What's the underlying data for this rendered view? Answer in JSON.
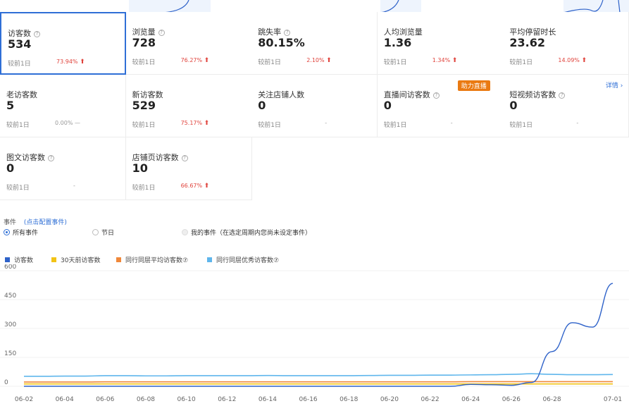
{
  "cards": [
    {
      "title": "访客数",
      "help": true,
      "value": "534",
      "compare_label": "较前1日",
      "change": "73.94%",
      "trend": "up",
      "selected": true
    },
    {
      "title": "浏览量",
      "help": true,
      "value": "728",
      "compare_label": "较前1日",
      "change": "76.27%",
      "trend": "up"
    },
    {
      "title": "跳失率",
      "help": true,
      "value": "80.15%",
      "compare_label": "较前1日",
      "change": "2.10%",
      "trend": "up"
    },
    {
      "title": "人均浏览量",
      "help": false,
      "value": "1.36",
      "compare_label": "较前1日",
      "change": "1.34%",
      "trend": "up"
    },
    {
      "title": "平均停留时长",
      "help": false,
      "value": "23.62",
      "compare_label": "较前1日",
      "change": "14.09%",
      "trend": "up"
    },
    {
      "title": "老访客数",
      "help": false,
      "value": "5",
      "compare_label": "较前1日",
      "change": "0.00% —",
      "trend": "flat"
    },
    {
      "title": "新访客数",
      "help": false,
      "value": "529",
      "compare_label": "较前1日",
      "change": "75.17%",
      "trend": "up"
    },
    {
      "title": "关注店铺人数",
      "help": false,
      "value": "0",
      "compare_label": "较前1日",
      "change": "-",
      "trend": "none"
    },
    {
      "title": "直播间访客数",
      "help": true,
      "value": "0",
      "compare_label": "较前1日",
      "change": "-",
      "trend": "none",
      "badge": "助力直播"
    },
    {
      "title": "短视频访客数",
      "help": true,
      "value": "0",
      "compare_label": "较前1日",
      "change": "-",
      "trend": "none",
      "detail": "详情 ›"
    },
    {
      "title": "图文访客数",
      "help": true,
      "value": "0",
      "compare_label": "较前1日",
      "change": "-",
      "trend": "none"
    },
    {
      "title": "店铺页访客数",
      "help": true,
      "value": "10",
      "compare_label": "较前1日",
      "change": "66.67%",
      "trend": "up"
    }
  ],
  "events": {
    "label": "事件",
    "config_link": "(点击配置事件)",
    "options": [
      {
        "label": "所有事件",
        "state": "on"
      },
      {
        "label": "节日",
        "state": "off"
      },
      {
        "label": "我的事件（在选定周期内您尚未设定事件）",
        "state": "disabled"
      }
    ]
  },
  "legend": [
    {
      "label": "访客数",
      "color": "#2e62c9"
    },
    {
      "label": "30天前访客数",
      "color": "#f2c316"
    },
    {
      "label": "同行同层平均访客数⑦",
      "color": "#f0883a"
    },
    {
      "label": "同行同层优秀访客数⑦",
      "color": "#5fb6ec"
    }
  ],
  "chart_data": {
    "type": "line",
    "x": [
      "06-02",
      "06-03",
      "06-04",
      "06-05",
      "06-06",
      "06-07",
      "06-08",
      "06-09",
      "06-10",
      "06-11",
      "06-12",
      "06-13",
      "06-14",
      "06-15",
      "06-16",
      "06-17",
      "06-18",
      "06-19",
      "06-20",
      "06-21",
      "06-22",
      "06-23",
      "06-24",
      "06-25",
      "06-26",
      "06-27",
      "06-28",
      "06-29",
      "06-30",
      "07-01"
    ],
    "xticks": [
      "06-02",
      "06-04",
      "06-06",
      "06-08",
      "06-10",
      "06-12",
      "06-14",
      "06-16",
      "06-18",
      "06-20",
      "06-22",
      "06-24",
      "06-26",
      "06-28",
      "07-01"
    ],
    "yticks": [
      0,
      150,
      300,
      450,
      600
    ],
    "ylim": [
      0,
      600
    ],
    "series": [
      {
        "name": "访客数",
        "color": "#2e62c9",
        "values": [
          0,
          0,
          0,
          0,
          0,
          0,
          0,
          0,
          0,
          0,
          0,
          0,
          0,
          0,
          0,
          0,
          0,
          0,
          0,
          0,
          0,
          0,
          10,
          8,
          5,
          20,
          180,
          330,
          307,
          534
        ]
      },
      {
        "name": "30天前访客数",
        "color": "#f2c316",
        "values": [
          12,
          12,
          12,
          12,
          12,
          12,
          12,
          12,
          12,
          12,
          12,
          12,
          12,
          12,
          12,
          12,
          12,
          12,
          12,
          12,
          12,
          12,
          12,
          12,
          12,
          12,
          12,
          12,
          12,
          12
        ]
      },
      {
        "name": "同行同层平均访客数⑦",
        "color": "#f0883a",
        "values": [
          22,
          22,
          22,
          22,
          23,
          23,
          23,
          23,
          23,
          23,
          23,
          23,
          23,
          23,
          23,
          23,
          23,
          23,
          23,
          23,
          23,
          23,
          24,
          24,
          24,
          24,
          24,
          24,
          24,
          24
        ]
      },
      {
        "name": "同行同层优秀访客数⑦",
        "color": "#5fb6ec",
        "values": [
          52,
          52,
          53,
          53,
          55,
          55,
          54,
          54,
          55,
          55,
          55,
          55,
          56,
          55,
          55,
          55,
          55,
          56,
          57,
          57,
          58,
          58,
          59,
          60,
          62,
          65,
          62,
          60,
          60,
          61
        ]
      }
    ]
  }
}
